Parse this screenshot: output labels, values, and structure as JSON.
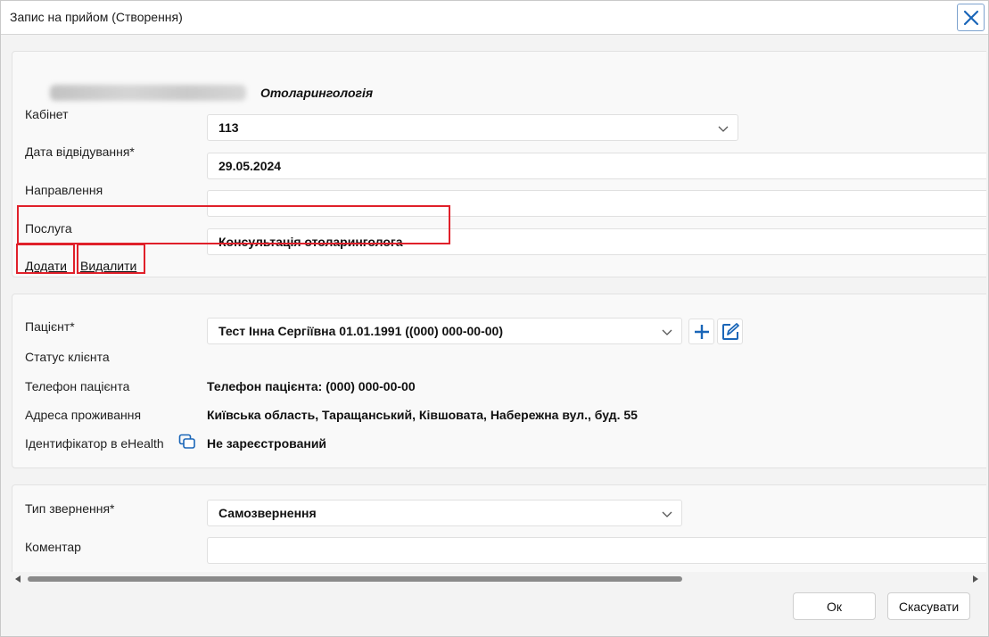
{
  "window": {
    "title": "Запис на прийом (Створення)"
  },
  "header": {
    "specialty": "Отоларингологія"
  },
  "appointment": {
    "cabinet_label": "Кабінет",
    "cabinet_value": "113",
    "visit_date_label": "Дата відвідування*",
    "visit_date_value": "29.05.2024",
    "referral_label": "Направлення",
    "referral_value": "",
    "service_label": "Послуга",
    "service_value": "Консультація отоларинголога",
    "add_link": "Додати",
    "delete_link": "Видалити"
  },
  "patient": {
    "patient_label": "Пацієнт*",
    "patient_value": "Тест Інна Сергіївна 01.01.1991 ((000) 000-00-00)",
    "client_status_label": "Статус клієнта",
    "phone_label": "Телефон пацієнта",
    "phone_value": "Телефон пацієнта: (000) 000-00-00",
    "address_label": "Адреса проживання",
    "address_value": "Київська область, Таращанський, Ківшовата, Набережна вул., буд. 55",
    "ehealth_label": "Ідентифікатор в eHealth",
    "ehealth_value": "Не зареєстрований"
  },
  "request": {
    "type_label": "Тип звернення*",
    "type_value": "Самозвернення",
    "comment_label": "Коментар",
    "comment_value": ""
  },
  "footer": {
    "ok_label": "Ок",
    "cancel_label": "Скасувати"
  },
  "icons": {
    "close": "close-icon",
    "chevron": "chevron-down-icon",
    "add_patient": "plus-icon",
    "edit_patient": "edit-icon",
    "copy": "copy-icon"
  },
  "colors": {
    "accent": "#1a66b8",
    "highlight": "#e0202a"
  }
}
